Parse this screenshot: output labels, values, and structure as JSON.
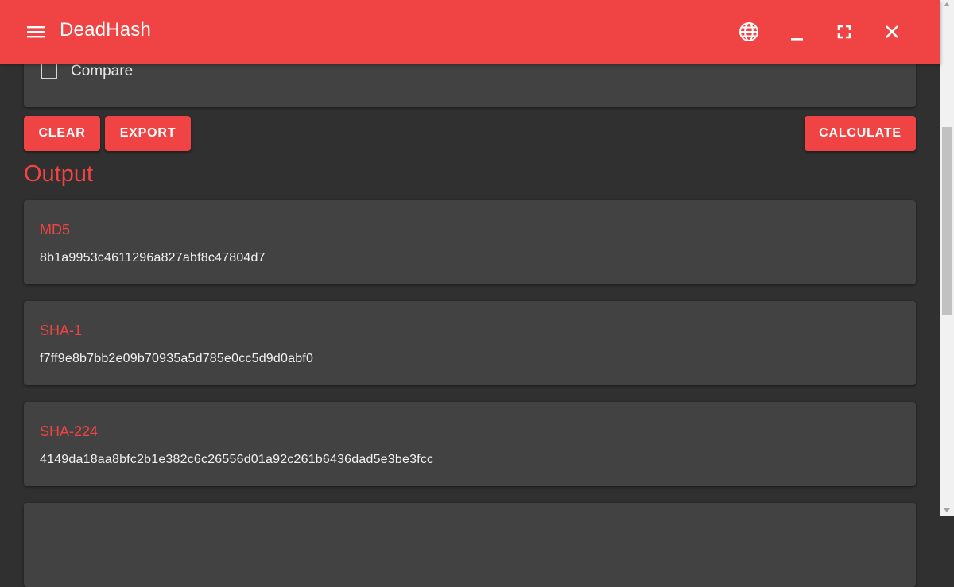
{
  "app": {
    "title": "DeadHash"
  },
  "icons": {
    "menu": "menu-icon",
    "language": "globe-icon",
    "minimize": "minimize-icon",
    "fullscreen": "fullscreen-icon",
    "close": "close-icon"
  },
  "colors": {
    "accent": "#f04343",
    "background": "#303030",
    "card": "#424242"
  },
  "compare": {
    "label": "Compare",
    "checked": false
  },
  "actions": {
    "clear": "CLEAR",
    "export": "EXPORT",
    "calculate": "CALCULATE"
  },
  "output": {
    "title": "Output",
    "hashes": [
      {
        "name": "MD5",
        "value": "8b1a9953c4611296a827abf8c47804d7"
      },
      {
        "name": "SHA-1",
        "value": "f7ff9e8b7bb2e09b70935a5d785e0cc5d9d0abf0"
      },
      {
        "name": "SHA-224",
        "value": "4149da18aa8bfc2b1e382c6c26556d01a92c261b6436dad5e3be3fcc"
      }
    ]
  }
}
